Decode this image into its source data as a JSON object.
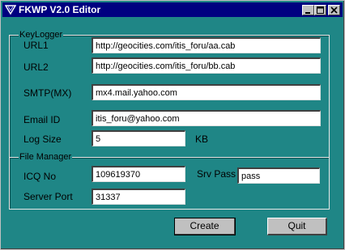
{
  "window": {
    "title": "FKWP  V2.0 Editor",
    "icons": {
      "app": "app-icon",
      "minimize": "minimize-icon",
      "maximize": "maximize-icon",
      "close": "close-icon"
    }
  },
  "keylogger": {
    "group_label": "KeyLogger",
    "url1_label": "URL1",
    "url1_value": "http://geocities.com/itis_foru/aa.cab",
    "url2_label": "URL2",
    "url2_value": "http://geocities.com/itis_foru/bb.cab",
    "smtp_label": "SMTP(MX)",
    "smtp_value": "mx4.mail.yahoo.com",
    "email_label": "Email ID",
    "email_value": "itis_foru@yahoo.com",
    "logsize_label": "Log Size",
    "logsize_value": "5",
    "logsize_unit": "KB"
  },
  "file_manager": {
    "group_label": "File Manager",
    "icq_label": "ICQ No",
    "icq_value": "109619370",
    "srvpass_label": "Srv Pass",
    "srvpass_value": "pass",
    "port_label": "Server Port",
    "port_value": "31337"
  },
  "buttons": {
    "create_label": "Create",
    "quit_label": "Quit"
  },
  "colors": {
    "background": "#1f8686",
    "titlebar": "#000080"
  }
}
